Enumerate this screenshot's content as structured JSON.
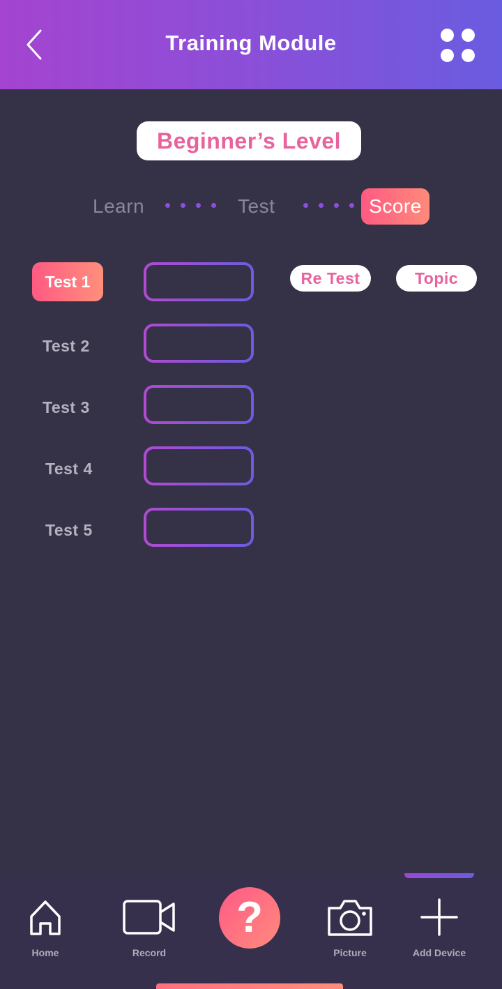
{
  "header": {
    "title": "Training Module",
    "back_icon": "chevron-left-icon",
    "menu_icon": "grid-dots-icon"
  },
  "level": {
    "label": "Beginner’s Level"
  },
  "stepper": {
    "steps": [
      "Learn",
      "Test",
      "Score"
    ],
    "active": "Score"
  },
  "tests": {
    "items": [
      "Test 1",
      "Test 2",
      "Test 3",
      "Test 4",
      "Test 5"
    ],
    "active": "Test 1",
    "retest_label": "Re Test",
    "topic_label": "Topic"
  },
  "nav": {
    "home": "Home",
    "record": "Record",
    "help": "?",
    "picture": "Picture",
    "add_device": "Add Device"
  },
  "colors": {
    "background": "#353247",
    "header_start": "#a444d0",
    "header_end": "#6a5ce0",
    "accent_pink": "#ff5a82",
    "pill_text": "#e8629c"
  }
}
